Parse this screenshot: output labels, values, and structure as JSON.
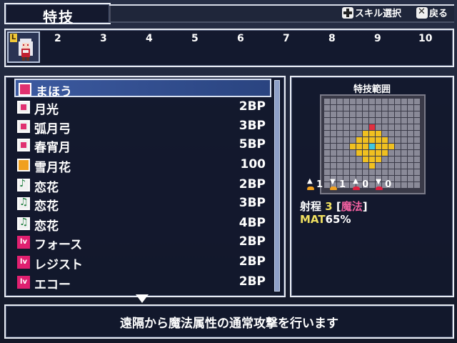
{
  "header": {
    "title": "特技",
    "hint_skill_select": "スキル選択",
    "hint_back": "戻る",
    "dpad_icon": "dpad-icon",
    "x_button_icon": "x-button-icon"
  },
  "party": {
    "leader_badge": "L",
    "slots": [
      "2",
      "3",
      "4",
      "5",
      "6",
      "7",
      "8",
      "9",
      "10"
    ]
  },
  "skills": [
    {
      "name": "まほう",
      "cost": "",
      "icon": "magic-icon",
      "selected": true
    },
    {
      "name": "月光",
      "cost": "2BP",
      "icon": "pink-gem-icon"
    },
    {
      "name": "弧月弓",
      "cost": "3BP",
      "icon": "pink-gem-icon"
    },
    {
      "name": "春宵月",
      "cost": "5BP",
      "icon": "pink-gem-icon"
    },
    {
      "name": "雪月花",
      "cost": "100",
      "icon": "flower-icon"
    },
    {
      "name": "恋花",
      "cost": "2BP",
      "icon": "note-icon"
    },
    {
      "name": "恋花",
      "cost": "3BP",
      "icon": "note-plus-icon"
    },
    {
      "name": "恋花",
      "cost": "4BP",
      "icon": "note-plus-icon"
    },
    {
      "name": "フォース",
      "cost": "2BP",
      "icon": "level-icon"
    },
    {
      "name": "レジスト",
      "cost": "2BP",
      "icon": "level-icon"
    },
    {
      "name": "エコー",
      "cost": "2BP",
      "icon": "level-icon"
    }
  ],
  "range_panel": {
    "title": "特技範囲",
    "arrows": [
      {
        "dir": "up",
        "color": "gold",
        "value": "1"
      },
      {
        "dir": "down",
        "color": "gold",
        "value": "1"
      },
      {
        "dir": "up",
        "color": "red",
        "value": "0"
      },
      {
        "dir": "down",
        "color": "red",
        "value": "0"
      }
    ],
    "range_label": "射程",
    "range_value": "3",
    "range_type_open": "[",
    "range_type": "魔法",
    "range_type_close": "]",
    "mat_label": "MAT",
    "mat_value": "65%"
  },
  "description": "遠隔から魔法属性の通常攻撃を行います"
}
